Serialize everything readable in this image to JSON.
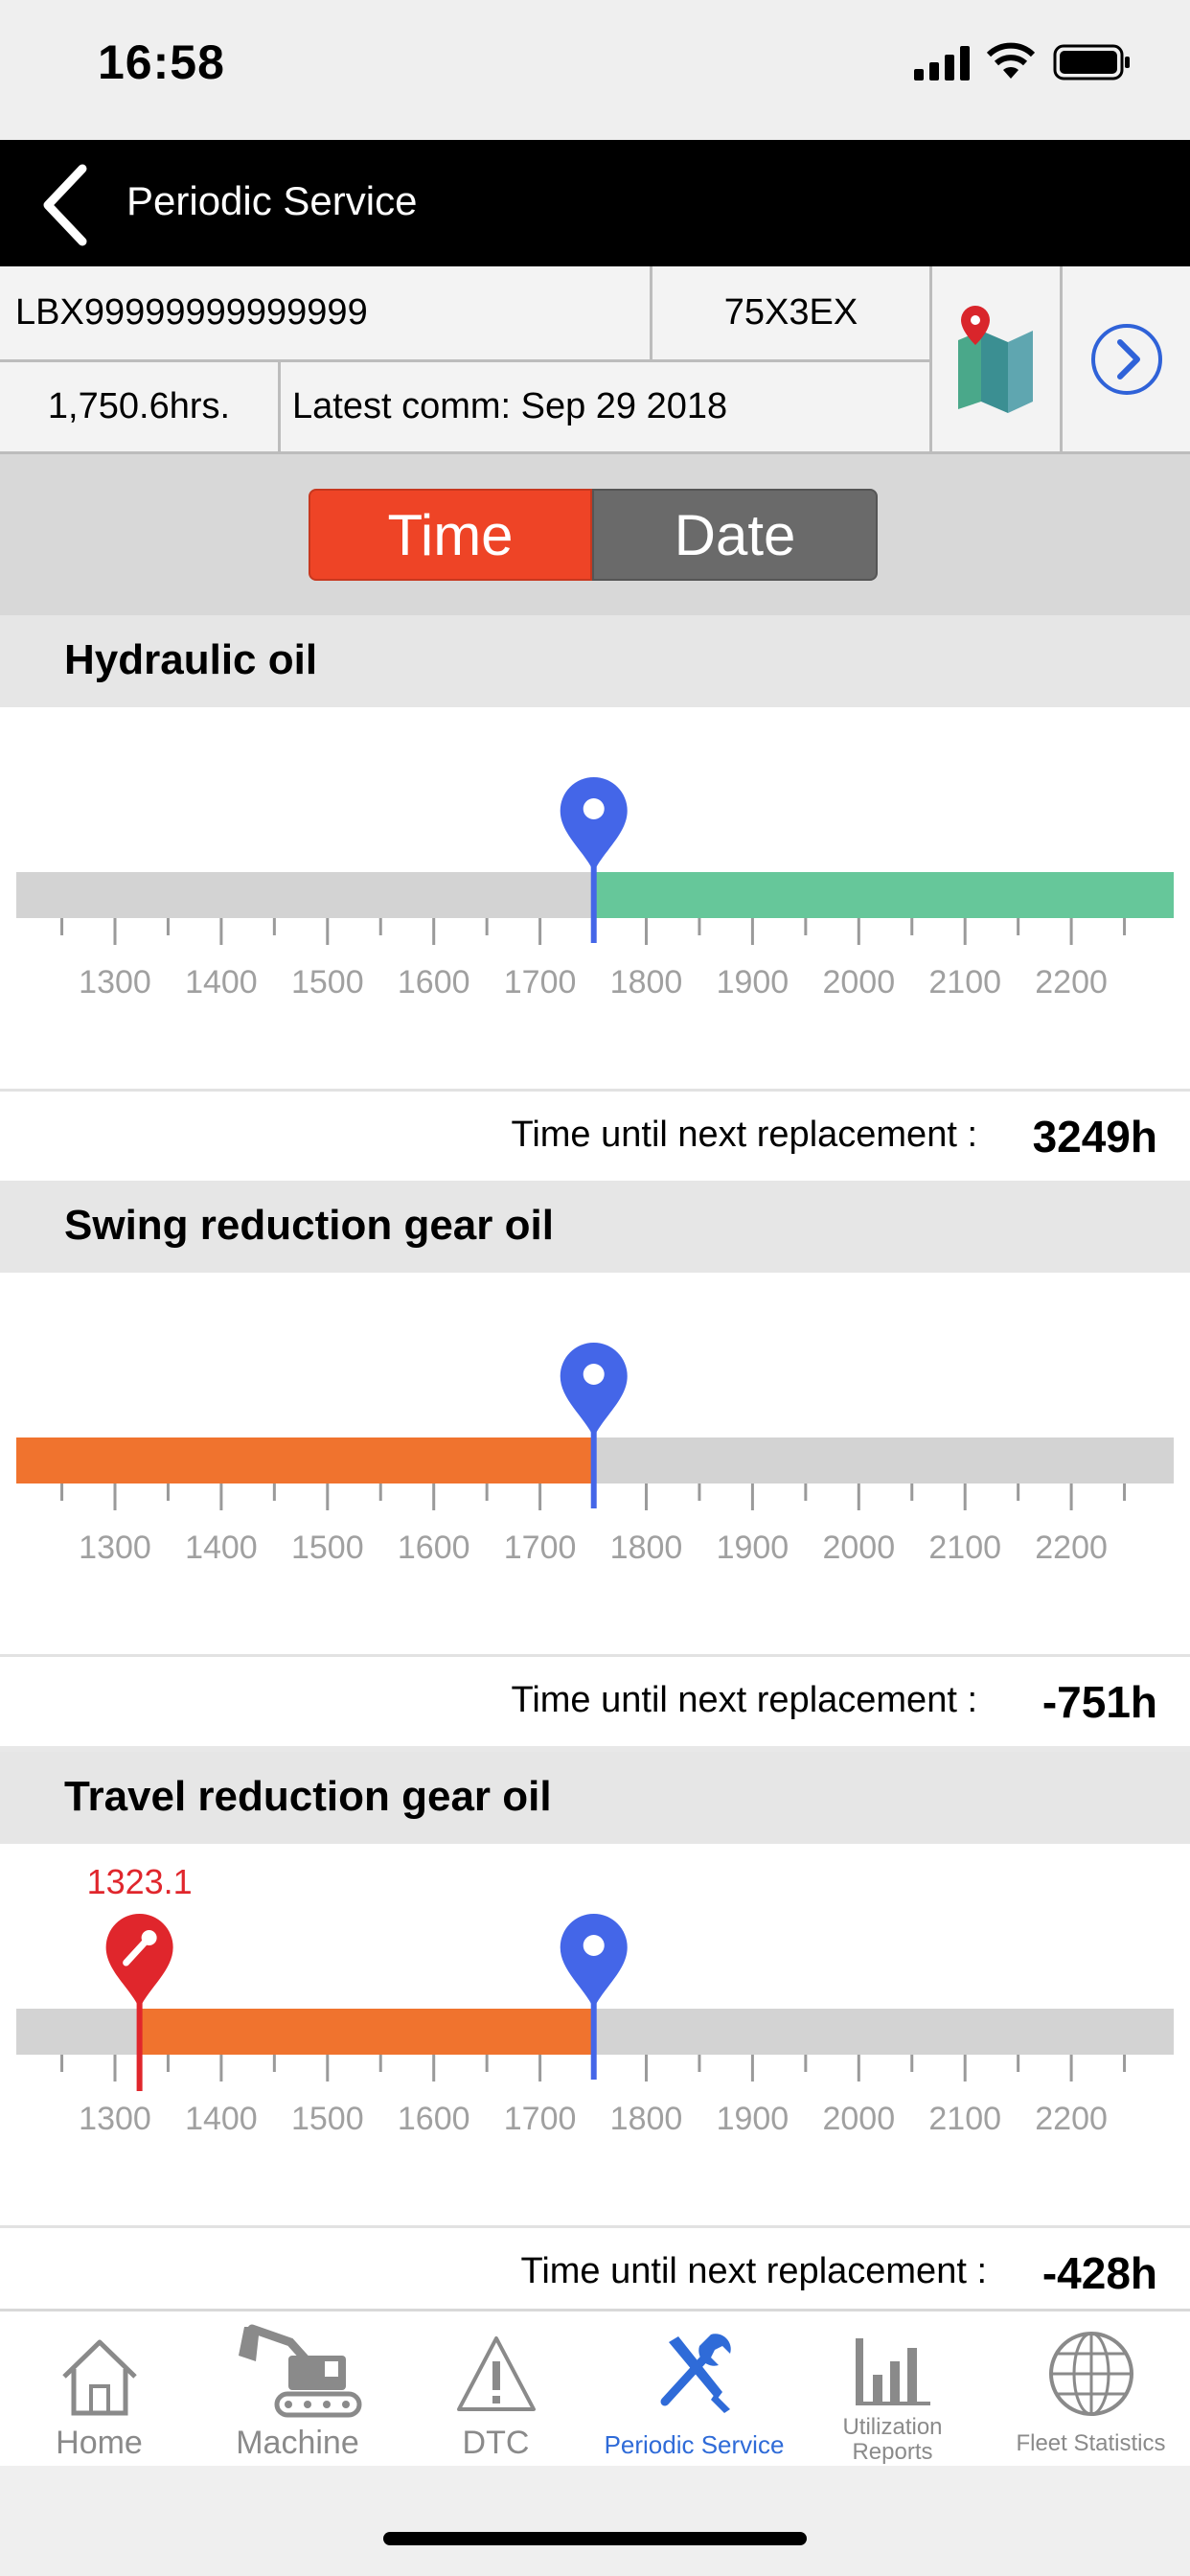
{
  "status_bar": {
    "time": "16:58"
  },
  "nav": {
    "title": "Periodic Service"
  },
  "machine": {
    "serial": "LBX99999999999999",
    "model": "75X3EX",
    "hours": "1,750.6hrs.",
    "latest_comm": "Latest comm: Sep 29 2018"
  },
  "toggle": {
    "time_label": "Time",
    "date_label": "Date",
    "selected": "Time"
  },
  "colors": {
    "orange": "#f0732e",
    "green": "#66c79a",
    "blue": "#4466e8",
    "red": "#e0262c",
    "selected_tab": "#2f6bd8",
    "segment_active": "#ee4426",
    "segment_inactive": "#6a6a6a"
  },
  "sections": [
    {
      "title": "Hydraulic oil",
      "current": 1750.6,
      "fill": "green",
      "fill_from": 1750.6,
      "fill_to": 2300,
      "footer_label": "Time until next replacement :",
      "footer_value": "3249h"
    },
    {
      "title": "Swing reduction gear oil",
      "current": 1750.6,
      "fill": "orange",
      "fill_from": 1200,
      "fill_to": 1750.6,
      "footer_label": "Time until next replacement :",
      "footer_value": "-751h"
    },
    {
      "title": "Travel reduction gear oil",
      "current": 1750.6,
      "fill": "orange",
      "fill_from": 1323.1,
      "fill_to": 1750.6,
      "service_marker": 1323.1,
      "service_label": "1323.1",
      "footer_label": "Time until next replacement :",
      "footer_value": "-428h"
    }
  ],
  "axis": {
    "ticks": [
      "1300",
      "1400",
      "1500",
      "1600",
      "1700",
      "1800",
      "1900",
      "2000",
      "2100",
      "2200"
    ]
  },
  "tabs": [
    {
      "label": "Home",
      "icon": "home-icon"
    },
    {
      "label": "Machine",
      "icon": "excavator-icon"
    },
    {
      "label": "DTC",
      "icon": "warning-icon"
    },
    {
      "label": "Periodic Service",
      "icon": "wrench-screwdriver-icon",
      "selected": true
    },
    {
      "label": "Utilization Reports",
      "icon": "bar-chart-icon"
    },
    {
      "label": "Fleet Statistics",
      "icon": "globe-icon"
    }
  ]
}
